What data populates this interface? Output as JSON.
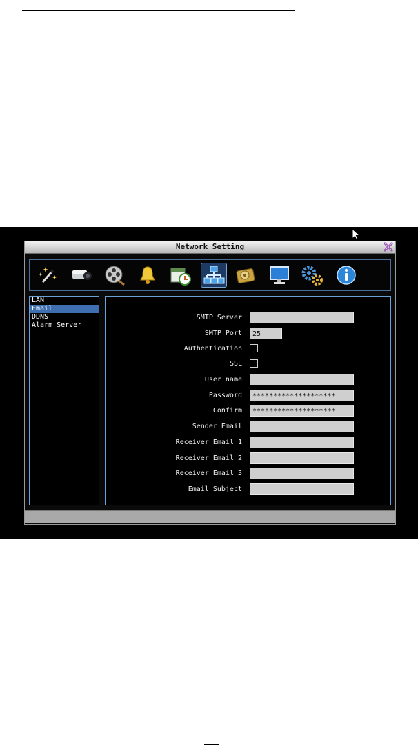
{
  "window": {
    "title": "Network Setting"
  },
  "toolbar": {
    "icons": [
      "magic-wand-icon",
      "camera-icon",
      "film-reel-icon",
      "bell-icon",
      "schedule-icon",
      "network-icon",
      "hard-disk-icon",
      "monitor-icon",
      "gears-icon",
      "info-icon"
    ],
    "active": "network-icon"
  },
  "sidebar": {
    "items": [
      {
        "label": "LAN"
      },
      {
        "label": "Email"
      },
      {
        "label": "DDNS"
      },
      {
        "label": "Alarm Server"
      }
    ],
    "selected": "Email"
  },
  "form": {
    "smtp_server": {
      "label": "SMTP Server",
      "value": ""
    },
    "smtp_port": {
      "label": "SMTP Port",
      "value": "25"
    },
    "authentication": {
      "label": "Authentication",
      "checked": false
    },
    "ssl": {
      "label": "SSL",
      "checked": false
    },
    "user_name": {
      "label": "User name",
      "value": ""
    },
    "password": {
      "label": "Password",
      "value": "********************"
    },
    "confirm": {
      "label": "Confirm",
      "value": "********************"
    },
    "sender_email": {
      "label": "Sender Email",
      "value": ""
    },
    "receiver_email_1": {
      "label": "Receiver Email 1",
      "value": ""
    },
    "receiver_email_2": {
      "label": "Receiver Email 2",
      "value": ""
    },
    "receiver_email_3": {
      "label": "Receiver Email 3",
      "value": ""
    },
    "email_subject": {
      "label": "Email Subject",
      "value": ""
    }
  },
  "colors": {
    "accent": "#3f6fb0",
    "panel_border": "#6aa0d8",
    "field_bg": "#cfcfcf"
  }
}
